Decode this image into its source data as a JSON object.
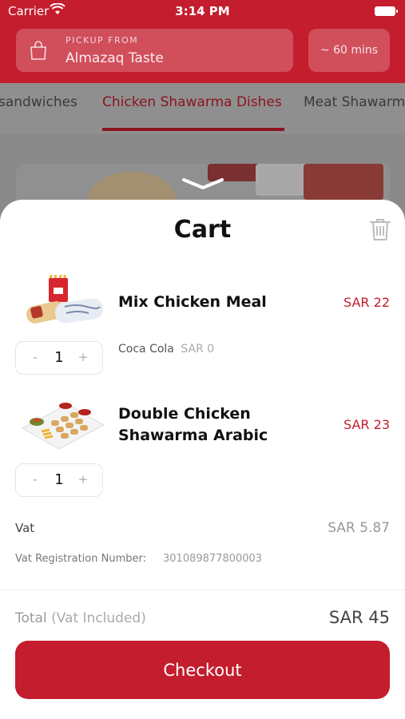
{
  "status_bar": {
    "carrier": "Carrier",
    "time": "3:14 PM"
  },
  "header": {
    "pickup_label": "PICKUP FROM",
    "restaurant": "Almazaq Taste",
    "eta": "~ 60 mins"
  },
  "categories": {
    "tabs": [
      {
        "label": "sandwiches"
      },
      {
        "label": "Chicken Shawarma Dishes",
        "active": true
      },
      {
        "label": "Meat Shawarma"
      }
    ]
  },
  "cart": {
    "title": "Cart",
    "items": [
      {
        "name": "Mix Chicken Meal",
        "price": "SAR 22",
        "quantity": "1",
        "addon": {
          "name": "Coca Cola",
          "price": "SAR 0"
        }
      },
      {
        "name_line1": "Double Chicken",
        "name_line2": "Shawarma Arabic",
        "price": "SAR 23",
        "quantity": "1"
      }
    ],
    "stepper": {
      "minus": "-",
      "plus": "+"
    },
    "vat_label": "Vat",
    "vat_value": "SAR 5.87",
    "vat_reg_label": "Vat Registration Number:",
    "vat_reg_value": "301089877800003",
    "total_label": "Total",
    "total_suffix": "(Vat Included)",
    "total_value": "SAR 45",
    "checkout_label": "Checkout"
  },
  "colors": {
    "brand": "#c41d2d",
    "price": "#c41d2d"
  },
  "icons": [
    "wifi-icon",
    "battery-icon",
    "shopping-bag-icon",
    "chevron-down-icon",
    "trash-icon"
  ]
}
